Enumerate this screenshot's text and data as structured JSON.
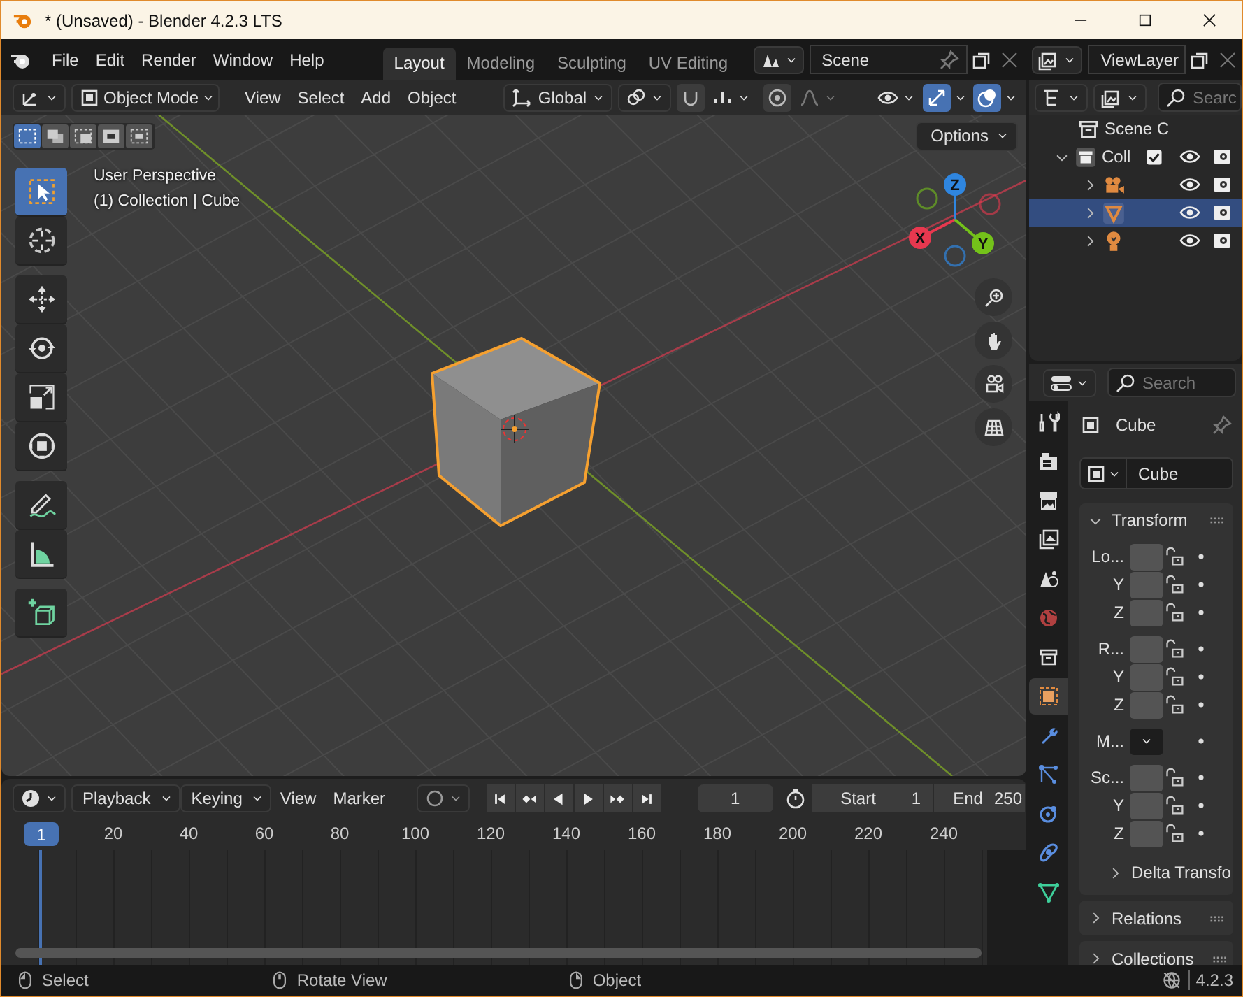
{
  "window": {
    "title": "* (Unsaved) - Blender 4.2.3 LTS"
  },
  "menu": [
    "File",
    "Edit",
    "Render",
    "Window",
    "Help"
  ],
  "workspaces": [
    {
      "label": "Layout",
      "selected": true
    },
    {
      "label": "Modeling",
      "selected": false
    },
    {
      "label": "Sculpting",
      "selected": false
    },
    {
      "label": "UV Editing",
      "selected": false
    }
  ],
  "scene": {
    "value": "Scene"
  },
  "view_layer": {
    "value": "ViewLayer"
  },
  "viewport": {
    "mode": "Object Mode",
    "menus": [
      "View",
      "Select",
      "Add",
      "Object"
    ],
    "orientation": "Global",
    "toggles": [
      {
        "kind": "snap",
        "on": false
      },
      {
        "kind": "proportional",
        "on": false
      },
      {
        "kind": "gizmo",
        "on": true
      },
      {
        "kind": "overlay",
        "on": true
      }
    ],
    "select_modes": [
      {
        "selected": true
      },
      {
        "selected": false
      },
      {
        "selected": false
      },
      {
        "selected": false
      },
      {
        "selected": false
      }
    ],
    "options": "Options",
    "overlay_text": [
      "User Perspective",
      "(1) Collection | Cube"
    ],
    "tools": [
      {
        "kind": "select",
        "selected": true
      },
      {
        "kind": "cursor",
        "selected": false
      },
      {
        "kind": "move",
        "selected": false
      },
      {
        "kind": "rotate",
        "selected": false
      },
      {
        "kind": "scale",
        "selected": false
      },
      {
        "kind": "transform",
        "selected": false
      },
      {
        "kind": "annotate",
        "selected": false
      },
      {
        "kind": "measure",
        "selected": false
      },
      {
        "kind": "add_cube",
        "selected": false
      }
    ],
    "gizmo_axes": [
      "X",
      "Y",
      "Z"
    ]
  },
  "outliner": {
    "search": {
      "placeholder": "Searc"
    },
    "items": [
      {
        "kind": "scene",
        "label": "Scene C",
        "children": [
          {
            "kind": "collection",
            "label": "Coll",
            "checked": true,
            "expanded": true,
            "children": [
              {
                "kind": "camera",
                "selected": false,
                "expanded": false
              },
              {
                "kind": "mesh",
                "selected": true,
                "expanded": false
              },
              {
                "kind": "light",
                "selected": false,
                "expanded": false
              }
            ]
          }
        ]
      }
    ]
  },
  "properties": {
    "search": {
      "placeholder": "Search"
    },
    "tabs": [
      {
        "kind": "tool",
        "selected": false
      },
      {
        "kind": "render",
        "selected": false
      },
      {
        "kind": "output",
        "selected": false
      },
      {
        "kind": "view_layer",
        "selected": false
      },
      {
        "kind": "scene",
        "selected": false
      },
      {
        "kind": "world",
        "selected": false
      },
      {
        "kind": "collection",
        "selected": false
      },
      {
        "kind": "object",
        "selected": true
      },
      {
        "kind": "modifier",
        "selected": false
      },
      {
        "kind": "particles",
        "selected": false
      },
      {
        "kind": "physics",
        "selected": false
      },
      {
        "kind": "constraints",
        "selected": false
      },
      {
        "kind": "data",
        "selected": false
      }
    ],
    "object_name": "Cube",
    "data_name": "Cube",
    "transform": {
      "title": "Transform",
      "expanded": true,
      "groups": [
        {
          "kind": "vector",
          "label": "Lo...",
          "axes": [
            "Y",
            "Z"
          ]
        },
        {
          "kind": "vector",
          "label": "R...",
          "axes": [
            "Y",
            "Z"
          ]
        },
        {
          "kind": "dropdown",
          "label": "M..."
        },
        {
          "kind": "vector",
          "label": "Sc...",
          "axes": [
            "Y",
            "Z"
          ]
        }
      ],
      "subpanel": "Delta Transfo"
    },
    "panels": [
      "Relations",
      "Collections"
    ]
  },
  "timeline": {
    "menus": [
      "Playback",
      "Keying",
      "View",
      "Marker"
    ],
    "frame": "1",
    "start_label": "Start",
    "start": "1",
    "end_label": "End",
    "end": "250",
    "marker": "1",
    "ticks": [
      "20",
      "40",
      "60",
      "80",
      "100",
      "120",
      "140",
      "160",
      "180",
      "200",
      "220",
      "240"
    ]
  },
  "status_bar": {
    "hints": [
      "Select",
      "Rotate View",
      "Object"
    ],
    "version": "4.2.3"
  }
}
